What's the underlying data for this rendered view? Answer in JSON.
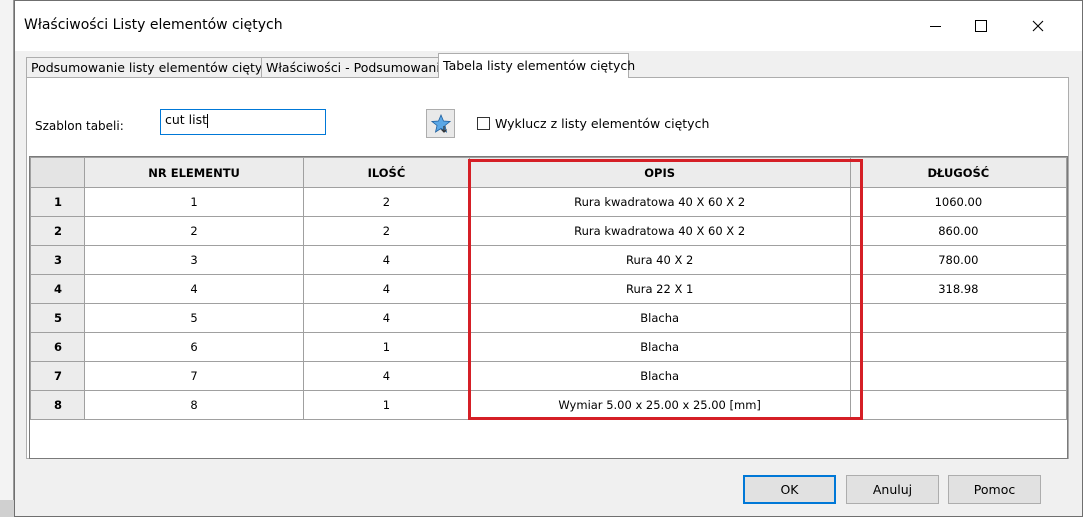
{
  "window": {
    "title": "Właściwości Listy elementów ciętych"
  },
  "tabs": [
    {
      "label": "Podsumowanie listy elementów ciętych",
      "active": false
    },
    {
      "label": "Właściwości - Podsumowanie",
      "active": false
    },
    {
      "label": "Tabela listy elementów ciętych",
      "active": true
    }
  ],
  "template": {
    "label": "Szablon tabeli:",
    "value": "cut list"
  },
  "exclude": {
    "label": "Wyklucz z listy elementów ciętych",
    "checked": false
  },
  "table": {
    "columns": [
      "NR ELEMENTU",
      "ILOŚĆ",
      "OPIS",
      "DŁUGOŚĆ"
    ],
    "rows": [
      {
        "index": "1",
        "nr": "1",
        "qty": "2",
        "desc": "Rura kwadratowa 40 X 60 X 2",
        "len": "1060.00"
      },
      {
        "index": "2",
        "nr": "2",
        "qty": "2",
        "desc": "Rura kwadratowa 40 X 60 X 2",
        "len": "860.00"
      },
      {
        "index": "3",
        "nr": "3",
        "qty": "4",
        "desc": "Rura 40 X 2",
        "len": "780.00"
      },
      {
        "index": "4",
        "nr": "4",
        "qty": "4",
        "desc": "Rura 22 X 1",
        "len": "318.98"
      },
      {
        "index": "5",
        "nr": "5",
        "qty": "4",
        "desc": "Blacha",
        "len": ""
      },
      {
        "index": "6",
        "nr": "6",
        "qty": "1",
        "desc": "Blacha",
        "len": ""
      },
      {
        "index": "7",
        "nr": "7",
        "qty": "4",
        "desc": "Blacha",
        "len": ""
      },
      {
        "index": "8",
        "nr": "8",
        "qty": "1",
        "desc": "Wymiar 5.00 x 25.00 x 25.00 [mm]",
        "len": ""
      }
    ]
  },
  "buttons": {
    "ok": "OK",
    "cancel": "Anuluj",
    "help": "Pomoc"
  },
  "colors": {
    "highlight": "#d51f26",
    "focus": "#0078d7"
  }
}
